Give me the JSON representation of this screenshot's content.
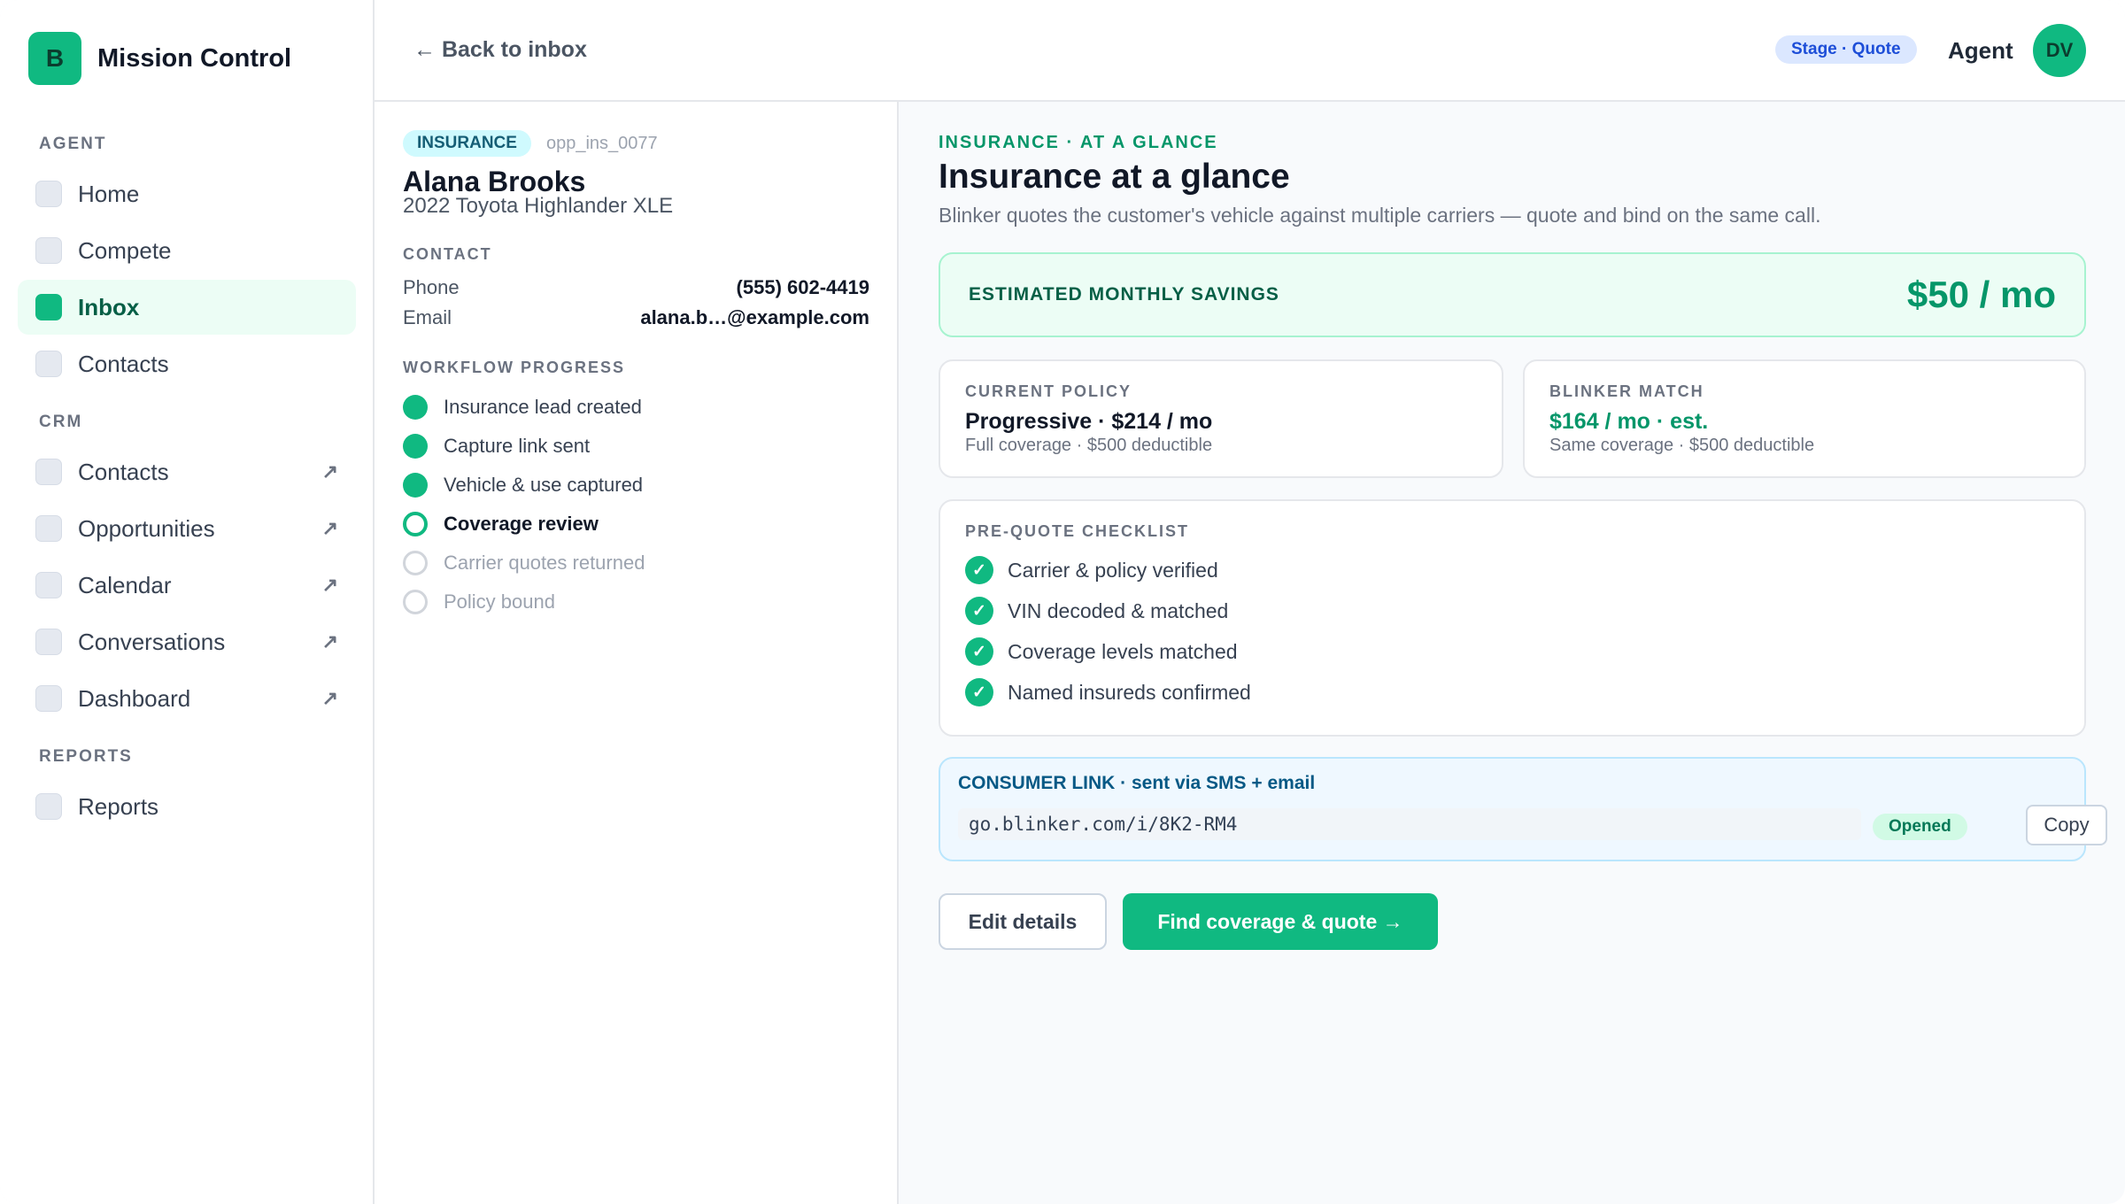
{
  "app": {
    "logo_letter": "B",
    "name": "Mission Control",
    "brand_color": "#10b981"
  },
  "sidebar": {
    "sections": [
      {
        "label": "AGENT",
        "items": [
          {
            "label": "Home",
            "active": false,
            "external": false
          },
          {
            "label": "Compete",
            "active": false,
            "external": false
          },
          {
            "label": "Inbox",
            "active": true,
            "external": false
          },
          {
            "label": "Contacts",
            "active": false,
            "external": false
          }
        ]
      },
      {
        "label": "CRM",
        "items": [
          {
            "label": "Contacts",
            "active": false,
            "external": true
          },
          {
            "label": "Opportunities",
            "active": false,
            "external": true
          },
          {
            "label": "Calendar",
            "active": false,
            "external": true
          },
          {
            "label": "Conversations",
            "active": false,
            "external": true
          },
          {
            "label": "Dashboard",
            "active": false,
            "external": true
          }
        ]
      },
      {
        "label": "REPORTS",
        "items": [
          {
            "label": "Reports",
            "active": false,
            "external": false
          }
        ]
      }
    ],
    "external_icon": "↗"
  },
  "header": {
    "back_label": "← Back to inbox",
    "stage": "Stage · Quote",
    "role": "Agent",
    "avatar_initials": "DV"
  },
  "lead": {
    "badge": "INSURANCE",
    "opp_id": "opp_ins_0077",
    "name": "Alana Brooks",
    "vehicle": "2022 Toyota Highlander XLE",
    "contact_label": "CONTACT",
    "contact": [
      {
        "key": "Phone",
        "value": "(555) 602-4419"
      },
      {
        "key": "Email",
        "value": "alana.b…@example.com"
      }
    ],
    "workflow_label": "WORKFLOW PROGRESS",
    "workflow": [
      {
        "label": "Insurance lead created",
        "status": "done"
      },
      {
        "label": "Capture link sent",
        "status": "done"
      },
      {
        "label": "Vehicle & use captured",
        "status": "done"
      },
      {
        "label": "Coverage review",
        "status": "current"
      },
      {
        "label": "Carrier quotes returned",
        "status": "pending"
      },
      {
        "label": "Policy bound",
        "status": "pending"
      }
    ]
  },
  "main": {
    "eyebrow": "INSURANCE · AT A GLANCE",
    "title": "Insurance at a glance",
    "subtitle": "Blinker quotes the customer's vehicle against multiple carriers — quote and bind on the same call.",
    "savings": {
      "label": "ESTIMATED MONTHLY SAVINGS",
      "value": "$50 / mo"
    },
    "current_policy": {
      "label": "CURRENT POLICY",
      "main": "Progressive · $214 / mo",
      "sub": "Full coverage · $500 deductible"
    },
    "blinker_match": {
      "label": "BLINKER MATCH",
      "main": "$164 / mo · est.",
      "sub": "Same coverage · $500 deductible"
    },
    "checklist": {
      "label": "PRE-QUOTE CHECKLIST",
      "items": [
        "Carrier & policy verified",
        "VIN decoded & matched",
        "Coverage levels matched",
        "Named insureds confirmed"
      ],
      "check_glyph": "✓"
    },
    "consumer_link": {
      "title": "CONSUMER LINK · sent via SMS + email",
      "url": "go.blinker.com/i/8K2-RM4",
      "status": "Opened",
      "copy_label": "Copy"
    },
    "actions": {
      "edit_label": "Edit details",
      "primary_label": "Find coverage & quote →"
    }
  }
}
